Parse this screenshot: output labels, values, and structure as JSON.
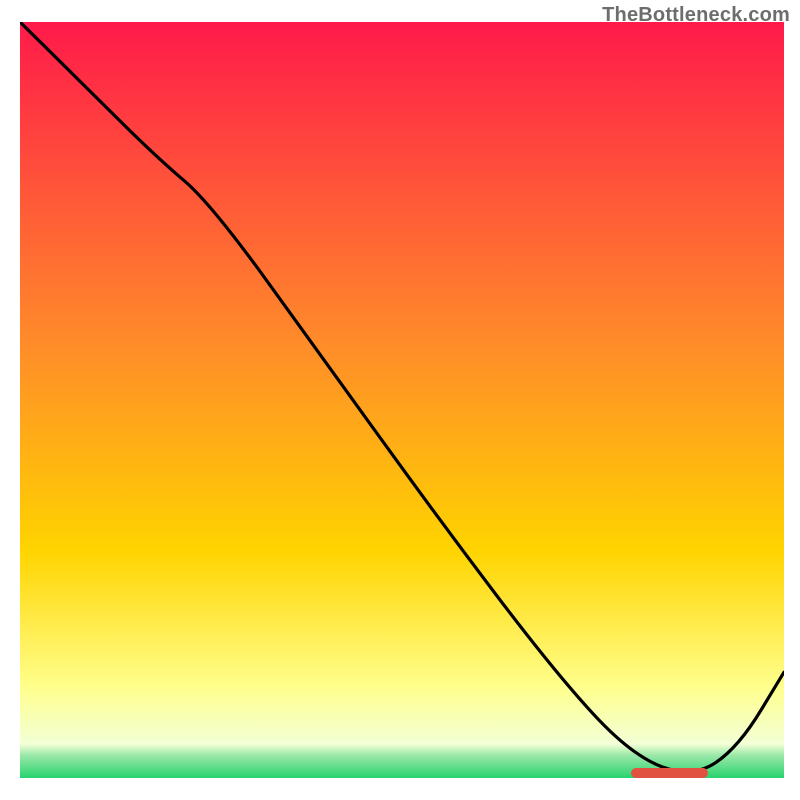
{
  "watermark": "TheBottleneck.com",
  "colors": {
    "gradient_top": "#ff1a4a",
    "gradient_mid1": "#ff7a2a",
    "gradient_mid2": "#ffd400",
    "gradient_mid3": "#ffff8c",
    "gradient_bottom_band": "#27d36e",
    "line": "#000000",
    "marker": "#e15241",
    "watermark_text": "#6d6d6d"
  },
  "chart_data": {
    "type": "line",
    "title": "",
    "xlabel": "",
    "ylabel": "",
    "xlim": [
      0,
      100
    ],
    "ylim": [
      0,
      100
    ],
    "notes": "Vertical axis appears to represent a bottleneck/error metric (high = red, low = green). No axis ticks shown.",
    "series": [
      {
        "name": "curve",
        "x": [
          0,
          8,
          18,
          25,
          40,
          55,
          70,
          80,
          88,
          94,
          100
        ],
        "values": [
          100,
          92,
          82,
          76,
          55,
          34,
          14,
          3,
          0,
          4,
          14
        ]
      }
    ],
    "optimal_band_x": [
      80,
      90
    ],
    "background_gradient_stops": [
      {
        "pos": 0.0,
        "color": "#ff1a4a"
      },
      {
        "pos": 0.42,
        "color": "#ff8a2a"
      },
      {
        "pos": 0.7,
        "color": "#ffd400"
      },
      {
        "pos": 0.88,
        "color": "#ffff8c"
      },
      {
        "pos": 0.955,
        "color": "#f3ffd6"
      },
      {
        "pos": 0.97,
        "color": "#9be8a8"
      },
      {
        "pos": 1.0,
        "color": "#27d36e"
      }
    ]
  }
}
